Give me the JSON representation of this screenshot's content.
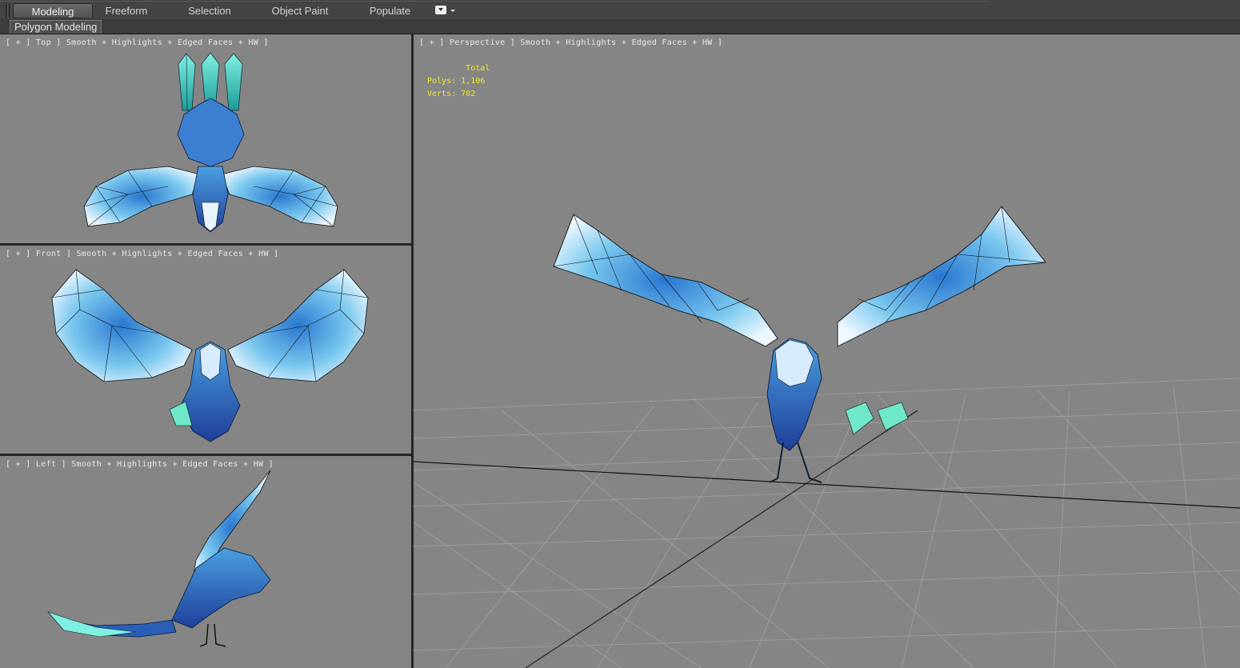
{
  "ribbon": {
    "tabs": [
      "Modeling",
      "Freeform",
      "Selection",
      "Object Paint",
      "Populate"
    ],
    "active_tab": "Modeling",
    "sub_tab": "Polygon Modeling"
  },
  "viewports": {
    "top": {
      "label": "[ + ] Top ] Smooth + Highlights + Edged Faces + HW ]"
    },
    "front": {
      "label": "[ + ] Front ] Smooth + Highlights + Edged Faces + HW ]"
    },
    "left": {
      "label": "[ + ] Left ] Smooth + Highlights + Edged Faces + HW ]"
    },
    "perspective": {
      "label": "[ + ] Perspective ] Smooth + Highlights + Edged Faces + HW ]"
    }
  },
  "stats": {
    "header": "Total",
    "polys_label": "Polys:",
    "polys_value": "1,106",
    "verts_label": "Verts:",
    "verts_value": "702"
  },
  "colors": {
    "viewport_bg": "#858585",
    "stats_text": "#f6ea1f",
    "ribbon_bg": "#444444"
  },
  "icons": [
    "ribbon-options-icon",
    "dropdown-arrow-icon"
  ]
}
